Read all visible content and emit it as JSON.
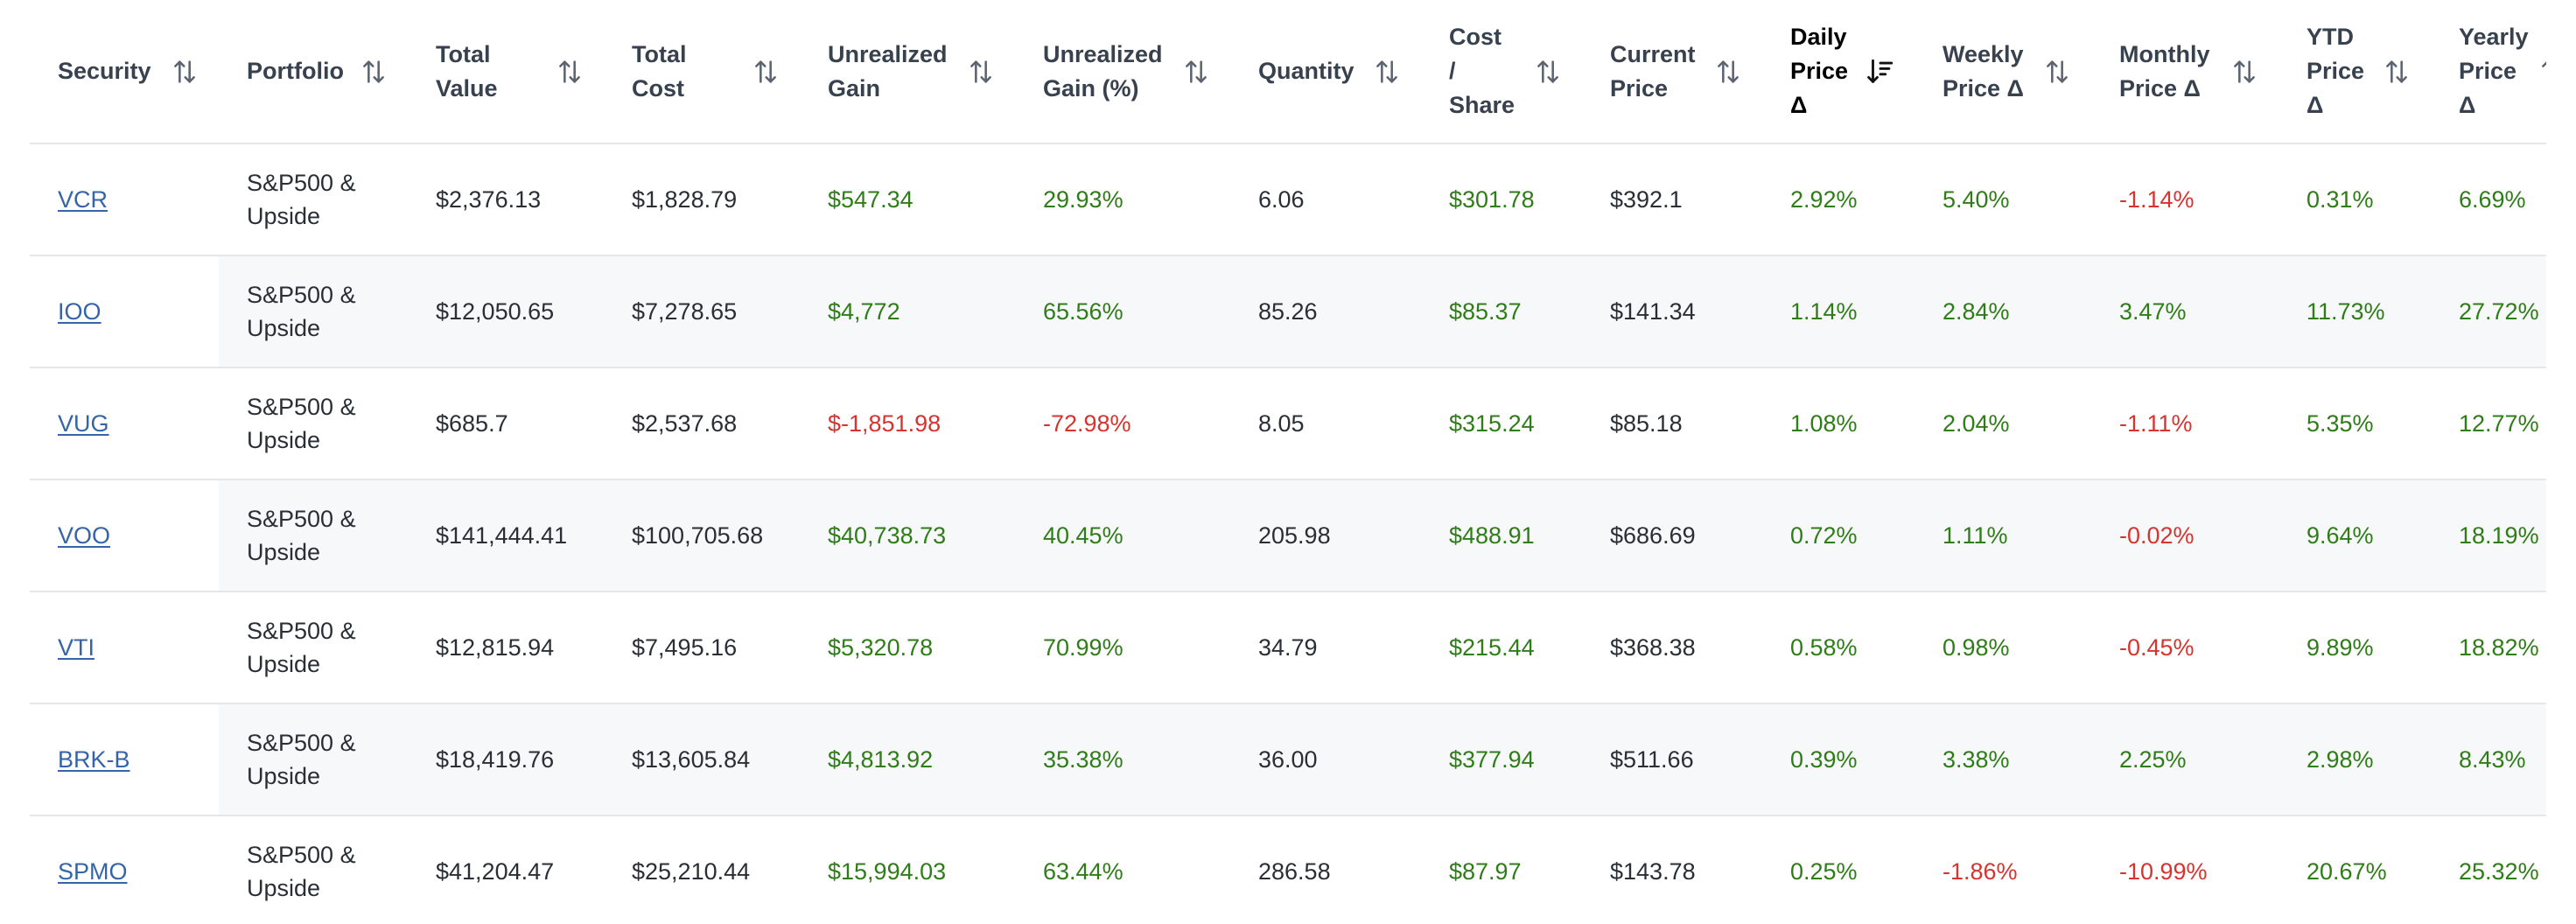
{
  "colors": {
    "positive": "#2f7d18",
    "negative": "#d5342f",
    "link": "#3565a8"
  },
  "columns": [
    {
      "label": "Security",
      "sort": "none"
    },
    {
      "label": "Portfolio",
      "sort": "none"
    },
    {
      "label": "Total\nValue",
      "sort": "none"
    },
    {
      "label": "Total\nCost",
      "sort": "none"
    },
    {
      "label": "Unrealized\nGain",
      "sort": "none"
    },
    {
      "label": "Unrealized\nGain (%)",
      "sort": "none"
    },
    {
      "label": "Quantity",
      "sort": "none"
    },
    {
      "label": "Cost\n/\nShare",
      "sort": "none"
    },
    {
      "label": "Current\nPrice",
      "sort": "none"
    },
    {
      "label": "Daily\nPrice\nΔ",
      "sort": "desc"
    },
    {
      "label": "Weekly\nPrice Δ",
      "sort": "none"
    },
    {
      "label": "Monthly\nPrice Δ",
      "sort": "none"
    },
    {
      "label": "YTD\nPrice\nΔ",
      "sort": "none"
    },
    {
      "label": "Yearly\nPrice\nΔ",
      "sort": "none"
    }
  ],
  "rows": [
    {
      "security": "VCR",
      "portfolio": "S&P500 &\nUpside",
      "total_value": "$2,376.13",
      "total_cost": "$1,828.79",
      "unrealized_gain": "$547.34",
      "unrealized_gain_pct": "29.93%",
      "quantity": "6.06",
      "cost_per_share": "$301.78",
      "current_price": "$392.1",
      "daily": "2.92%",
      "weekly": "5.40%",
      "monthly": "-1.14%",
      "ytd": "0.31%",
      "yearly": "6.69%"
    },
    {
      "security": "IOO",
      "portfolio": "S&P500 &\nUpside",
      "total_value": "$12,050.65",
      "total_cost": "$7,278.65",
      "unrealized_gain": "$4,772",
      "unrealized_gain_pct": "65.56%",
      "quantity": "85.26",
      "cost_per_share": "$85.37",
      "current_price": "$141.34",
      "daily": "1.14%",
      "weekly": "2.84%",
      "monthly": "3.47%",
      "ytd": "11.73%",
      "yearly": "27.72%"
    },
    {
      "security": "VUG",
      "portfolio": "S&P500 &\nUpside",
      "total_value": "$685.7",
      "total_cost": "$2,537.68",
      "unrealized_gain": "$-1,851.98",
      "unrealized_gain_pct": "-72.98%",
      "quantity": "8.05",
      "cost_per_share": "$315.24",
      "current_price": "$85.18",
      "daily": "1.08%",
      "weekly": "2.04%",
      "monthly": "-1.11%",
      "ytd": "5.35%",
      "yearly": "12.77%"
    },
    {
      "security": "VOO",
      "portfolio": "S&P500 &\nUpside",
      "total_value": "$141,444.41",
      "total_cost": "$100,705.68",
      "unrealized_gain": "$40,738.73",
      "unrealized_gain_pct": "40.45%",
      "quantity": "205.98",
      "cost_per_share": "$488.91",
      "current_price": "$686.69",
      "daily": "0.72%",
      "weekly": "1.11%",
      "monthly": "-0.02%",
      "ytd": "9.64%",
      "yearly": "18.19%"
    },
    {
      "security": "VTI",
      "portfolio": "S&P500 &\nUpside",
      "total_value": "$12,815.94",
      "total_cost": "$7,495.16",
      "unrealized_gain": "$5,320.78",
      "unrealized_gain_pct": "70.99%",
      "quantity": "34.79",
      "cost_per_share": "$215.44",
      "current_price": "$368.38",
      "daily": "0.58%",
      "weekly": "0.98%",
      "monthly": "-0.45%",
      "ytd": "9.89%",
      "yearly": "18.82%"
    },
    {
      "security": "BRK-B",
      "portfolio": "S&P500 &\nUpside",
      "total_value": "$18,419.76",
      "total_cost": "$13,605.84",
      "unrealized_gain": "$4,813.92",
      "unrealized_gain_pct": "35.38%",
      "quantity": "36.00",
      "cost_per_share": "$377.94",
      "current_price": "$511.66",
      "daily": "0.39%",
      "weekly": "3.38%",
      "monthly": "2.25%",
      "ytd": "2.98%",
      "yearly": "8.43%"
    },
    {
      "security": "SPMO",
      "portfolio": "S&P500 &\nUpside",
      "total_value": "$41,204.47",
      "total_cost": "$25,210.44",
      "unrealized_gain": "$15,994.03",
      "unrealized_gain_pct": "63.44%",
      "quantity": "286.58",
      "cost_per_share": "$87.97",
      "current_price": "$143.78",
      "daily": "0.25%",
      "weekly": "-1.86%",
      "monthly": "-10.99%",
      "ytd": "20.67%",
      "yearly": "25.32%"
    }
  ]
}
